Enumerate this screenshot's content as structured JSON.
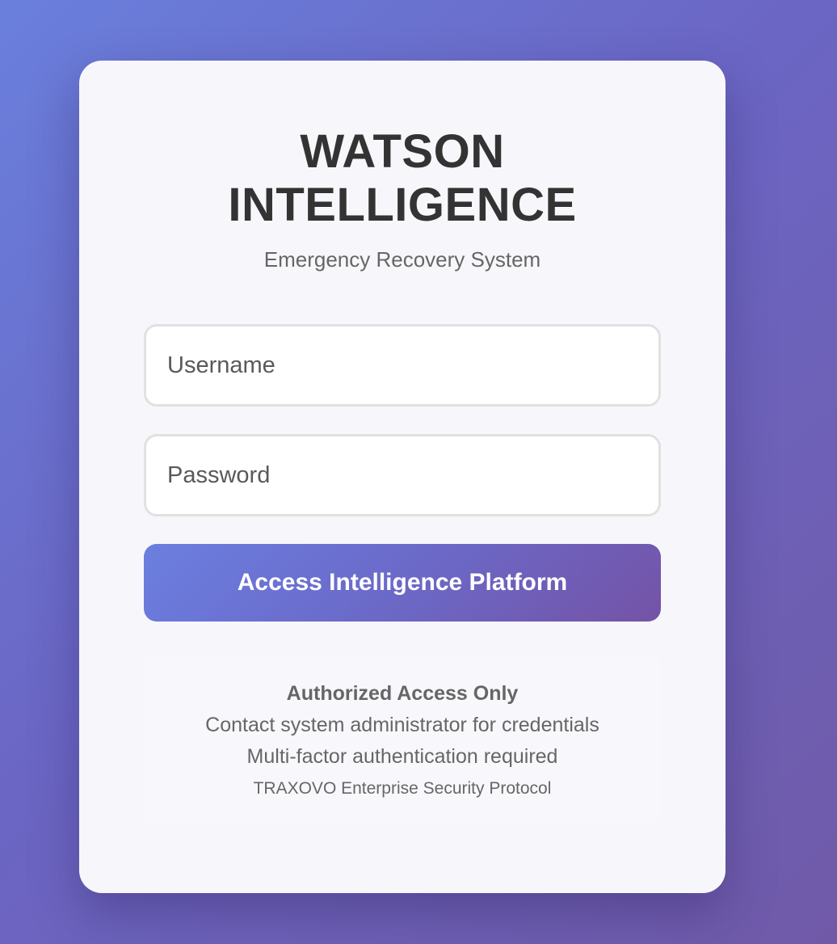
{
  "login": {
    "title_line1": "WATSON",
    "title_line2": "INTELLIGENCE",
    "subtitle": "Emergency Recovery System",
    "username_placeholder": "Username",
    "password_placeholder": "Password",
    "submit_label": "Access Intelligence Platform"
  },
  "notice": {
    "heading": "Authorized Access Only",
    "line1": "Contact system administrator for credentials",
    "line2": "Multi-factor authentication required",
    "line3": "TRAXOVO Enterprise Security Protocol"
  },
  "colors": {
    "background_start": "#6a7fdc",
    "background_end": "#705aa8",
    "card": "#f7f7fb",
    "title": "#333333",
    "muted_text": "#666666"
  }
}
